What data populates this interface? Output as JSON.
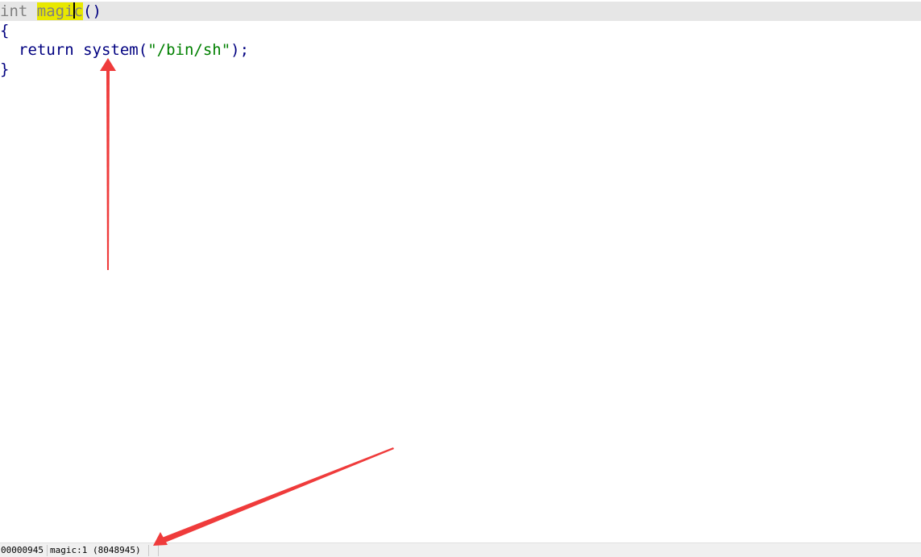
{
  "code": {
    "line1": {
      "type": "int",
      "name_before_cursor": "magi",
      "name_after_cursor": "c",
      "parens": "()"
    },
    "line2": {
      "text": "{"
    },
    "line3": {
      "keyword": "return",
      "func": "system",
      "open": "(",
      "string": "\"/bin/sh\"",
      "close": ");"
    },
    "line4": {
      "text": "}"
    }
  },
  "status_bar": {
    "address": "00000945",
    "location": "magic:1 (8048945)"
  },
  "colors": {
    "highlight": "#e8e800",
    "current_line": "#e6e6e6",
    "keyword": "#000080",
    "string": "#008000",
    "annotation_arrow": "#ef3b3b"
  },
  "annotations": {
    "arrow_count": 2
  }
}
